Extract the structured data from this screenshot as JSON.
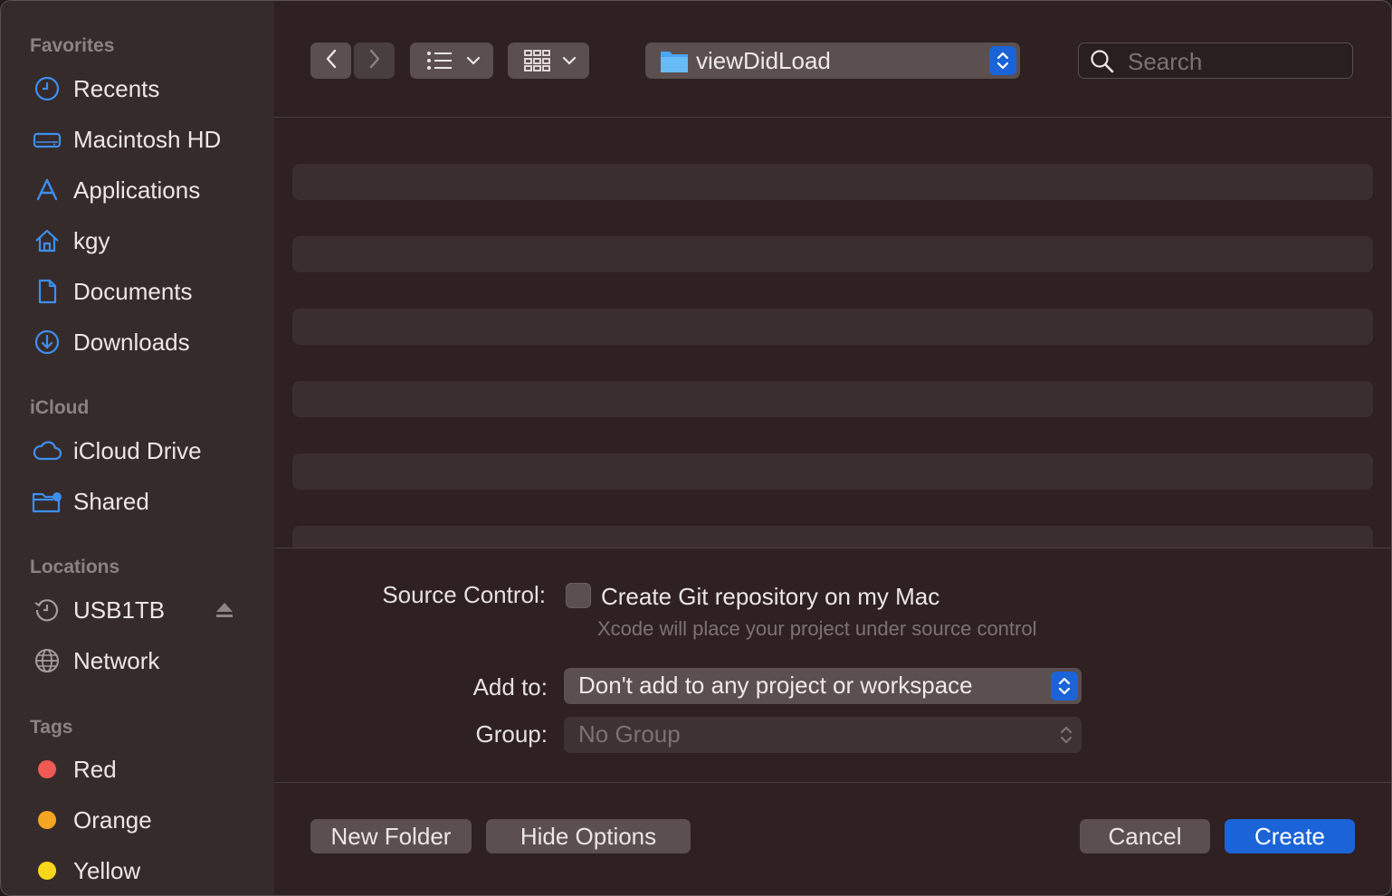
{
  "sidebar": {
    "favorites_title": "Favorites",
    "favorites": [
      {
        "label": "Recents",
        "icon": "clock-icon"
      },
      {
        "label": "Macintosh HD",
        "icon": "hard-drive-icon"
      },
      {
        "label": "Applications",
        "icon": "applications-icon"
      },
      {
        "label": "kgy",
        "icon": "home-icon"
      },
      {
        "label": "Documents",
        "icon": "document-icon"
      },
      {
        "label": "Downloads",
        "icon": "download-icon"
      }
    ],
    "icloud_title": "iCloud",
    "icloud": [
      {
        "label": "iCloud Drive",
        "icon": "cloud-icon"
      },
      {
        "label": "Shared",
        "icon": "shared-folder-icon"
      }
    ],
    "locations_title": "Locations",
    "locations": [
      {
        "label": "USB1TB",
        "icon": "time-machine-icon"
      },
      {
        "label": "Network",
        "icon": "globe-icon"
      }
    ],
    "tags_title": "Tags",
    "tags": [
      {
        "label": "Red",
        "color": "#ef5a54"
      },
      {
        "label": "Orange",
        "color": "#f5a524"
      },
      {
        "label": "Yellow",
        "color": "#f7d61c"
      }
    ]
  },
  "toolbar": {
    "current_folder": "viewDidLoad",
    "search_placeholder": "Search"
  },
  "options": {
    "source_control_label": "Source Control:",
    "git_checkbox_label": "Create Git repository on my Mac",
    "git_checked": false,
    "git_hint": "Xcode will place your project under source control",
    "add_to_label": "Add to:",
    "add_to_value": "Don't add to any project or workspace",
    "group_label": "Group:",
    "group_value": "No Group"
  },
  "buttons": {
    "new_folder": "New Folder",
    "hide_options": "Hide Options",
    "cancel": "Cancel",
    "create": "Create"
  },
  "colors": {
    "accent": "#1b64d8",
    "sidebar_icon": "#3d8ff0"
  }
}
